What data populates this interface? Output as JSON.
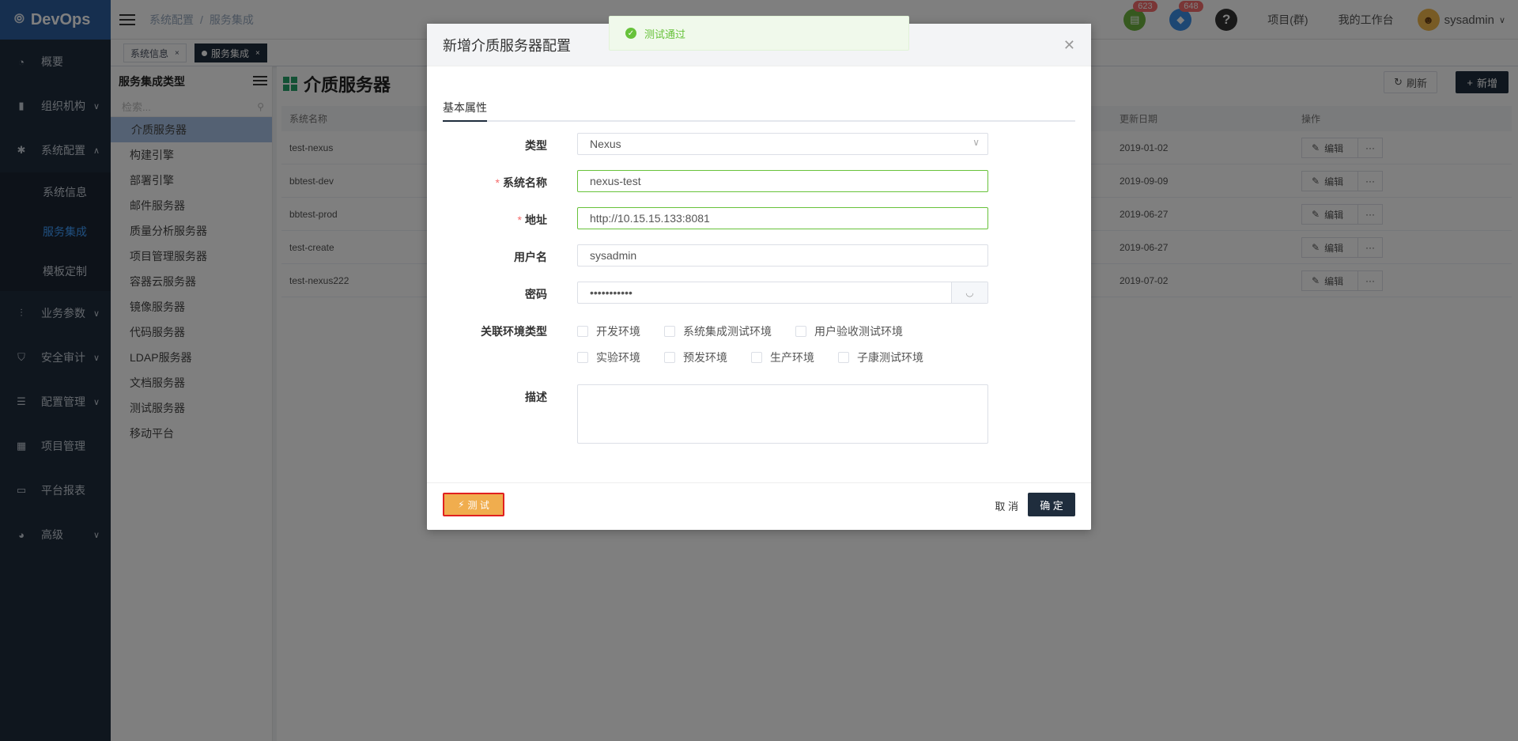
{
  "app": {
    "logo": "DevOps"
  },
  "sidebar": {
    "items": [
      {
        "label": "概要",
        "icon": "dashboard-icon"
      },
      {
        "label": "组织机构",
        "icon": "lock-icon"
      },
      {
        "label": "系统配置",
        "icon": "gear-icon"
      },
      {
        "label": "业务参数",
        "icon": "sliders-icon"
      },
      {
        "label": "安全审计",
        "icon": "shield-icon"
      },
      {
        "label": "配置管理",
        "icon": "database-icon"
      },
      {
        "label": "项目管理",
        "icon": "grid-icon"
      },
      {
        "label": "平台报表",
        "icon": "monitor-icon"
      },
      {
        "label": "高级",
        "icon": "palette-icon"
      }
    ],
    "submenu": [
      "系统信息",
      "服务集成",
      "模板定制"
    ]
  },
  "header": {
    "breadcrumb": [
      "系统配置",
      "服务集成"
    ],
    "badge_tasks": "623",
    "badge_notifications": "648",
    "help": "?",
    "link_projects": "项目(群)",
    "link_workbench": "我的工作台",
    "username": "sysadmin"
  },
  "tags": [
    {
      "label": "系统信息",
      "close": "×"
    },
    {
      "label": "服务集成",
      "close": "×"
    }
  ],
  "subpanel": {
    "title": "服务集成类型",
    "search_placeholder": "检索...",
    "items": [
      "介质服务器",
      "构建引擎",
      "部署引擎",
      "邮件服务器",
      "质量分析服务器",
      "项目管理服务器",
      "容器云服务器",
      "镜像服务器",
      "代码服务器",
      "LDAP服务器",
      "文档服务器",
      "测试服务器",
      "移动平台"
    ]
  },
  "main": {
    "title": "介质服务器",
    "refresh_label": "刷新",
    "add_label": "新增",
    "columns": {
      "name": "系统名称",
      "updated": "更新日期",
      "ops": "操作"
    },
    "rows": [
      {
        "name": "test-nexus",
        "date": "2019-01-02"
      },
      {
        "name": "bbtest-dev",
        "date": "2019-09-09"
      },
      {
        "name": "bbtest-prod",
        "date": "2019-06-27"
      },
      {
        "name": "test-create",
        "date": "2019-06-27"
      },
      {
        "name": "test-nexus222",
        "date": "2019-07-02"
      }
    ],
    "edit_label": "编辑",
    "more_label": "···"
  },
  "modal": {
    "title": "新增介质服务器配置",
    "tab": "基本属性",
    "fields": {
      "type_label": "类型",
      "type_value": "Nexus",
      "name_label": "系统名称",
      "name_value": "nexus-test",
      "address_label": "地址",
      "address_value": "http://10.15.15.133:8081",
      "username_label": "用户名",
      "username_value": "sysadmin",
      "password_label": "密码",
      "password_value": "•••••••••••",
      "env_label": "关联环境类型",
      "desc_label": "描述"
    },
    "envs": [
      "开发环境",
      "系统集成测试环境",
      "用户验收测试环境",
      "实验环境",
      "预发环境",
      "生产环境",
      "子康测试环境"
    ],
    "test_label": "测 试",
    "cancel_label": "取 消",
    "ok_label": "确 定"
  },
  "toast": {
    "message": "测试通过"
  }
}
